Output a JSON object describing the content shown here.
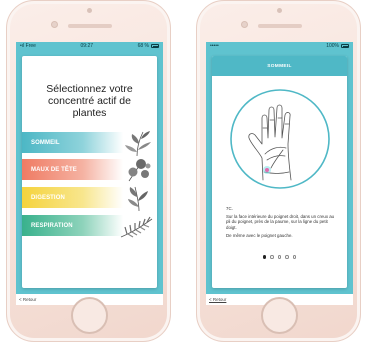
{
  "left_screen": {
    "status": {
      "carrier": "Free",
      "time": "09:27",
      "battery": "68 %"
    },
    "title": "Sélectionnez votre concentré actif de plantes",
    "options": [
      {
        "label": "SOMMEIL",
        "color": "#4cb7c5"
      },
      {
        "label": "MAUX DE TÊTE",
        "color": "#ef7b63"
      },
      {
        "label": "DIGESTION",
        "color": "#f5d33c"
      },
      {
        "label": "RESPIRATION",
        "color": "#38b18c"
      }
    ],
    "back": "< Retour"
  },
  "right_screen": {
    "status": {
      "signal": "•••••",
      "battery": "100%"
    },
    "header": "SOMMEIL",
    "point_code": "7C.",
    "instructions": "Sur la face intérieure du poignet droit, dans un creux au pli du poignet, près de la paume, sur la ligne du petit doigt.",
    "note": "De même avec le poignet gauche.",
    "pager": {
      "total": 5,
      "active": 1
    },
    "back": "< Retour"
  },
  "colors": {
    "screen_background": "#5fc3cf",
    "header_teal": "#4fb8c6",
    "point_pink": "#7de0e8",
    "phone_rose_gold": "#f6e2da"
  },
  "icons": [
    "signal-icon",
    "wifi-icon",
    "battery-icon",
    "hand-illustration-icon",
    "plant-icon"
  ]
}
